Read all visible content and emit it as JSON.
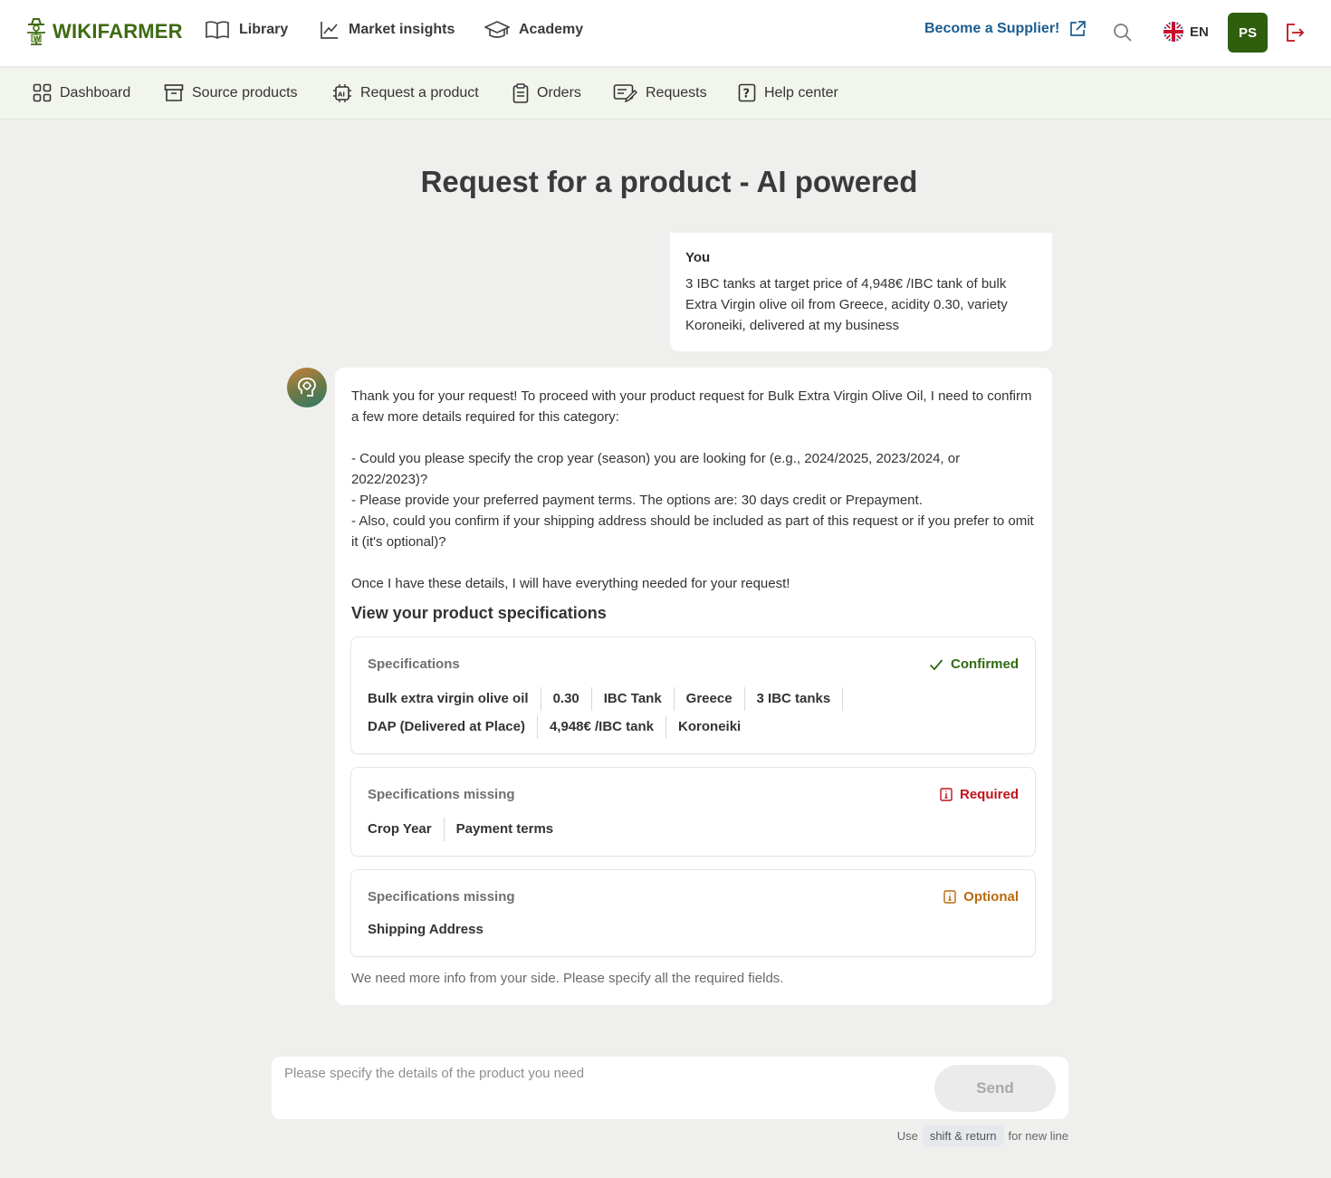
{
  "brand": {
    "name": "WIKIFARMER"
  },
  "topnav": {
    "items": [
      {
        "label": "Library",
        "icon": "book-icon"
      },
      {
        "label": "Market insights",
        "icon": "chart-line-icon"
      },
      {
        "label": "Academy",
        "icon": "graduation-cap-icon"
      }
    ],
    "supplier_label": "Become a Supplier!",
    "language": "EN",
    "avatar_initials": "PS"
  },
  "subnav": {
    "items": [
      {
        "label": "Dashboard",
        "icon": "grid-icon"
      },
      {
        "label": "Source products",
        "icon": "archive-box-icon"
      },
      {
        "label": "Request a product",
        "icon": "ai-chip-icon"
      },
      {
        "label": "Orders",
        "icon": "clipboard-icon"
      },
      {
        "label": "Requests",
        "icon": "edit-list-icon"
      },
      {
        "label": "Help center",
        "icon": "question-box-icon"
      }
    ]
  },
  "page": {
    "title": "Request for a product - AI powered"
  },
  "user_message": {
    "author": "You",
    "text": "3 IBC tanks at target price of 4,948€ /IBC tank of bulk Extra Virgin olive oil from Greece, acidity 0.30, variety Koroneiki, delivered at my business"
  },
  "ai_message": {
    "intro": "Thank you for your request! To proceed with your product request for Bulk Extra Virgin Olive Oil, I need to confirm a few more details required for this category:",
    "points": [
      "- Could you please specify the crop year (season) you are looking for (e.g., 2024/2025, 2023/2024, or 2022/2023)?",
      "- Please provide your preferred payment terms. The options are: 30 days credit or Prepayment.",
      "- Also, could you confirm if your shipping address should be included as part of this request or if you prefer to omit it (it's optional)?"
    ],
    "closing": "Once I have these details, I will have everything needed for your request!",
    "spec_heading": "View your product specifications",
    "footer": "We need more info from your side. Please specify all the required fields."
  },
  "cards": {
    "confirmed": {
      "title": "Specifications",
      "status": "Confirmed",
      "status_color": "#2f6a12",
      "row1": [
        "Bulk extra virgin olive oil",
        "0.30",
        "IBC Tank",
        "Greece",
        "3 IBC tanks"
      ],
      "row2": [
        "DAP (Delivered at Place)",
        "4,948€ /IBC tank",
        "Koroneiki"
      ]
    },
    "required": {
      "title": "Specifications missing",
      "status": "Required",
      "status_color": "#c0121b",
      "items": [
        "Crop Year",
        "Payment terms"
      ]
    },
    "optional": {
      "title": "Specifications missing",
      "status": "Optional",
      "status_color": "#b86a0c",
      "items": [
        "Shipping Address"
      ]
    }
  },
  "composer": {
    "placeholder": "Please specify the details of the product you need",
    "value": "",
    "send_label": "Send",
    "hint_prefix": "Use",
    "hint_key": "shift & return",
    "hint_suffix": "for new line"
  }
}
